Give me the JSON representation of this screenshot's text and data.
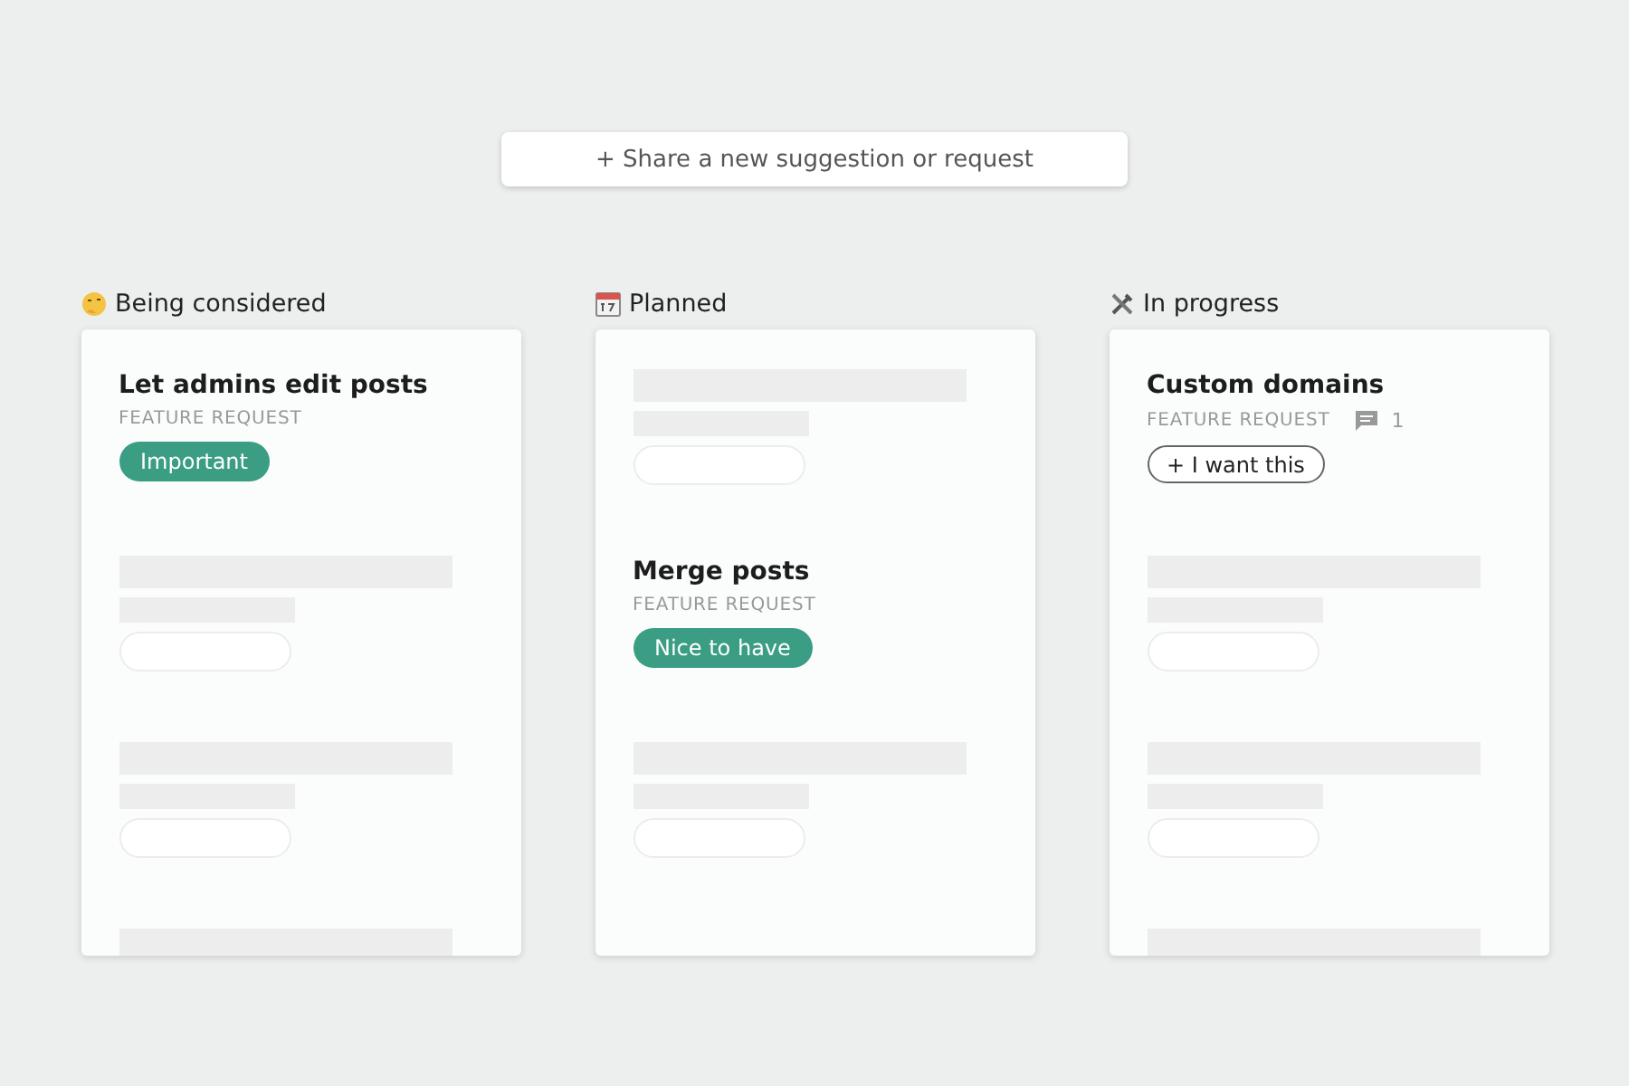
{
  "share_button": {
    "label": "+ Share a new suggestion or request"
  },
  "columns": [
    {
      "title": "Being considered",
      "items": [
        {
          "kind": "post",
          "title": "Let admins edit posts",
          "category": "FEATURE REQUEST",
          "action": {
            "kind": "tag",
            "label": "Important"
          }
        },
        {
          "kind": "placeholder"
        },
        {
          "kind": "placeholder"
        },
        {
          "kind": "placeholder_cut"
        }
      ]
    },
    {
      "title": "Planned",
      "items": [
        {
          "kind": "placeholder"
        },
        {
          "kind": "post",
          "title": "Merge posts",
          "category": "FEATURE REQUEST",
          "action": {
            "kind": "tag",
            "label": "Nice to have"
          }
        },
        {
          "kind": "placeholder"
        }
      ]
    },
    {
      "title": "In progress",
      "items": [
        {
          "kind": "post",
          "title": "Custom domains",
          "category": "FEATURE REQUEST",
          "comments": "1",
          "action": {
            "kind": "vote",
            "label": "+ I want this"
          }
        },
        {
          "kind": "placeholder"
        },
        {
          "kind": "placeholder"
        },
        {
          "kind": "placeholder_cut"
        }
      ]
    }
  ]
}
